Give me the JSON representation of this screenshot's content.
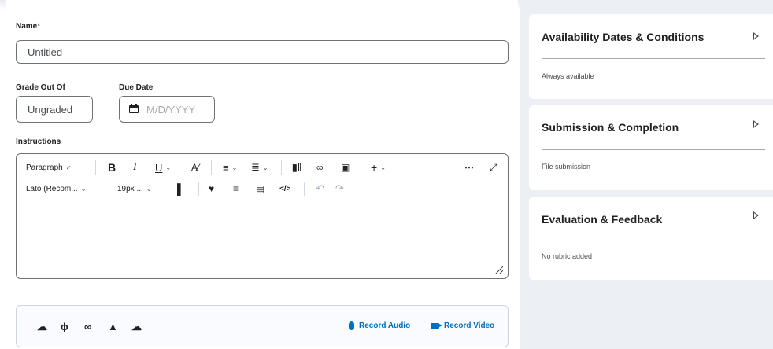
{
  "form": {
    "name_label": "Name",
    "name_required": "*",
    "name_value": "Untitled",
    "grade_label": "Grade Out Of",
    "grade_value": "Ungraded",
    "due_label": "Due Date",
    "due_placeholder": "M/D/YYYY",
    "instructions_label": "Instructions"
  },
  "editor": {
    "paragraph_label": "Paragraph",
    "font_label": "Lato (Recom...",
    "size_label": "19px ..."
  },
  "attachments": {
    "record_audio": "Record Audio",
    "record_video": "Record Video"
  },
  "sidebar": {
    "cards": [
      {
        "title": "Availability Dates & Conditions",
        "subtitle": "Always available"
      },
      {
        "title": "Submission & Completion",
        "subtitle": "File submission"
      },
      {
        "title": "Evaluation & Feedback",
        "subtitle": "No rubric added"
      }
    ]
  },
  "colors": {
    "accent": "#006fbf",
    "panel_bg": "#eceff4",
    "text": "#202122"
  }
}
